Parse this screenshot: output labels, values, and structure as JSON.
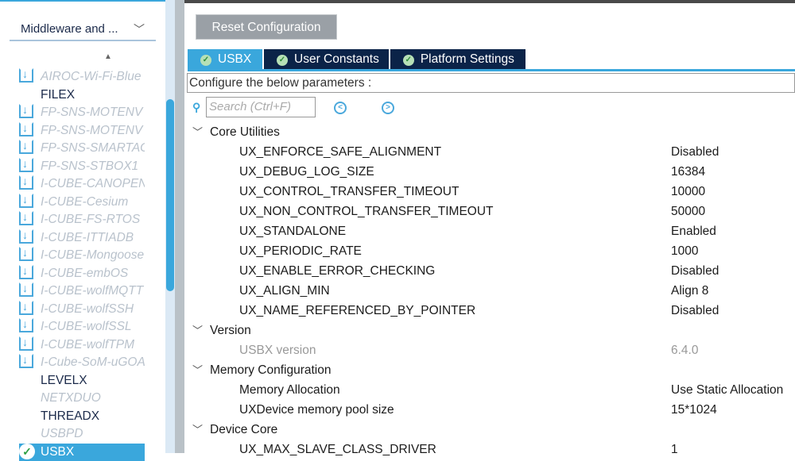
{
  "sidebar": {
    "category": "Middleware and ...",
    "items": [
      {
        "label": "AIROC-Wi-Fi-Blue",
        "kind": "dl"
      },
      {
        "label": "FILEX",
        "kind": "na"
      },
      {
        "label": "FP-SNS-MOTENV",
        "kind": "dl"
      },
      {
        "label": "FP-SNS-MOTENV",
        "kind": "dl"
      },
      {
        "label": "FP-SNS-SMARTAG",
        "kind": "dl"
      },
      {
        "label": "FP-SNS-STBOX1",
        "kind": "dl"
      },
      {
        "label": "I-CUBE-CANOPEN",
        "kind": "dl"
      },
      {
        "label": "I-CUBE-Cesium",
        "kind": "dl"
      },
      {
        "label": "I-CUBE-FS-RTOS",
        "kind": "dl"
      },
      {
        "label": "I-CUBE-ITTIADB",
        "kind": "dl"
      },
      {
        "label": "I-CUBE-Mongoose",
        "kind": "dl"
      },
      {
        "label": "I-CUBE-embOS",
        "kind": "dl"
      },
      {
        "label": "I-CUBE-wolfMQTT",
        "kind": "dl"
      },
      {
        "label": "I-CUBE-wolfSSH",
        "kind": "dl"
      },
      {
        "label": "I-CUBE-wolfSSL",
        "kind": "dl"
      },
      {
        "label": "I-CUBE-wolfTPM",
        "kind": "dl"
      },
      {
        "label": "I-Cube-SoM-uGOAL",
        "kind": "dl"
      },
      {
        "label": "LEVELX",
        "kind": "na"
      },
      {
        "label": "NETXDUO",
        "kind": "dis"
      },
      {
        "label": "THREADX",
        "kind": "na"
      },
      {
        "label": "USBPD",
        "kind": "dis"
      },
      {
        "label": "USBX",
        "kind": "sel"
      }
    ]
  },
  "toolbar": {
    "reset_label": "Reset Configuration"
  },
  "tabs": [
    "USBX",
    "User Constants",
    "Platform Settings"
  ],
  "configure_label": "Configure the below parameters :",
  "search": {
    "placeholder": "Search (Ctrl+F)"
  },
  "tree": [
    {
      "type": "group",
      "label": "Core Utilities"
    },
    {
      "type": "param",
      "name": "UX_ENFORCE_SAFE_ALIGNMENT",
      "value": "Disabled"
    },
    {
      "type": "param",
      "name": "UX_DEBUG_LOG_SIZE",
      "value": "16384"
    },
    {
      "type": "param",
      "name": "UX_CONTROL_TRANSFER_TIMEOUT",
      "value": "10000"
    },
    {
      "type": "param",
      "name": "UX_NON_CONTROL_TRANSFER_TIMEOUT",
      "value": "50000"
    },
    {
      "type": "param",
      "name": "UX_STANDALONE",
      "value": "Enabled"
    },
    {
      "type": "param",
      "name": "UX_PERIODIC_RATE",
      "value": "1000"
    },
    {
      "type": "param",
      "name": "UX_ENABLE_ERROR_CHECKING",
      "value": "Disabled"
    },
    {
      "type": "param",
      "name": "UX_ALIGN_MIN",
      "value": "Align 8"
    },
    {
      "type": "param",
      "name": "UX_NAME_REFERENCED_BY_POINTER",
      "value": "Disabled"
    },
    {
      "type": "group",
      "label": "Version"
    },
    {
      "type": "param",
      "name": "USBX version",
      "value": "6.4.0",
      "readonly": true
    },
    {
      "type": "group",
      "label": "Memory Configuration"
    },
    {
      "type": "param",
      "name": "Memory Allocation",
      "value": "Use Static Allocation"
    },
    {
      "type": "param",
      "name": "UXDevice memory pool size",
      "value": "15*1024"
    },
    {
      "type": "group",
      "label": "Device Core"
    },
    {
      "type": "param",
      "name": "UX_MAX_SLAVE_CLASS_DRIVER",
      "value": "1"
    }
  ]
}
